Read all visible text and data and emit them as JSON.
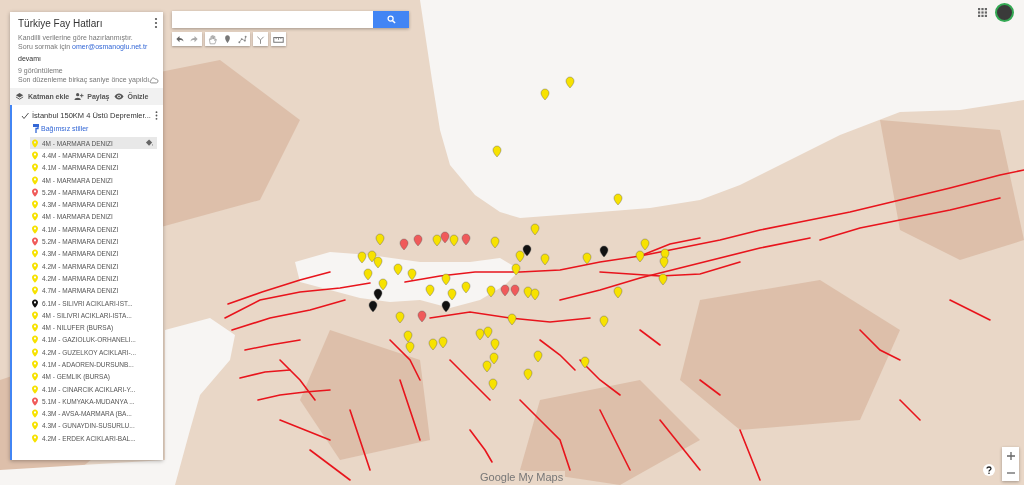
{
  "map": {
    "title": "Türkiye Fay Hatları",
    "description": "Kandilli verilerine göre hazırlanmıştır.",
    "contact_prefix": "Soru sormak için",
    "contact_email": "omer@osmanoglu.net.tr",
    "more": "devamı",
    "views": "9 görüntüleme",
    "last_edit": "Son düzenleme birkaç saniye önce yapıldı"
  },
  "actions": [
    {
      "kind": "layer",
      "label": "Katman ekle"
    },
    {
      "kind": "share",
      "label": "Paylaş"
    },
    {
      "kind": "preview",
      "label": "Önizle"
    }
  ],
  "layer": {
    "name": "İstanbul 150KM 4 Üstü Depremler...",
    "checked": true,
    "style_link": "Bağımsız stiller",
    "items": [
      {
        "label": "4M - MARMARA DENIZI",
        "color": "#f7e200",
        "selected": true
      },
      {
        "label": "4.4M - MARMARA DENIZI",
        "color": "#f7e200",
        "selected": false
      },
      {
        "label": "4.1M - MARMARA DENIZI",
        "color": "#f7e200",
        "selected": false
      },
      {
        "label": "4M - MARMARA DENIZI",
        "color": "#f7e200",
        "selected": false
      },
      {
        "label": "5.2M - MARMARA DENIZI",
        "color": "#f05a5a",
        "selected": false
      },
      {
        "label": "4.3M - MARMARA DENIZI",
        "color": "#f7e200",
        "selected": false
      },
      {
        "label": "4M - MARMARA DENIZI",
        "color": "#f7e200",
        "selected": false
      },
      {
        "label": "4.1M - MARMARA DENIZI",
        "color": "#f7e200",
        "selected": false
      },
      {
        "label": "5.2M - MARMARA DENIZI",
        "color": "#f05a5a",
        "selected": false
      },
      {
        "label": "4.3M - MARMARA DENIZI",
        "color": "#f7e200",
        "selected": false
      },
      {
        "label": "4.2M - MARMARA DENIZI",
        "color": "#f7e200",
        "selected": false
      },
      {
        "label": "4.2M - MARMARA DENIZI",
        "color": "#f7e200",
        "selected": false
      },
      {
        "label": "4.7M - MARMARA DENIZI",
        "color": "#f7e200",
        "selected": false
      },
      {
        "label": "6.1M - SILIVRI ACIKLARI-IST...",
        "color": "#111111",
        "selected": false
      },
      {
        "label": "4M - SILIVRI ACIKLARI-ISTA...",
        "color": "#f7e200",
        "selected": false
      },
      {
        "label": "4M - NILUFER (BURSA)",
        "color": "#f7e200",
        "selected": false
      },
      {
        "label": "4.1M - GAZIOLUK-ORHANELI...",
        "color": "#f7e200",
        "selected": false
      },
      {
        "label": "4.2M - GUZELKOY ACIKLARI-...",
        "color": "#f7e200",
        "selected": false
      },
      {
        "label": "4.1M - ADAOREN-DURSUNB...",
        "color": "#f7e200",
        "selected": false
      },
      {
        "label": "4M - GEMLIK (BURSA)",
        "color": "#f7e200",
        "selected": false
      },
      {
        "label": "4.1M - CINARCIK ACIKLARI-Y...",
        "color": "#f7e200",
        "selected": false
      },
      {
        "label": "5.1M - KUMYAKA-MUDANYA ...",
        "color": "#f05a5a",
        "selected": false
      },
      {
        "label": "4.3M - AVSA-MARMARA (BA...",
        "color": "#f7e200",
        "selected": false
      },
      {
        "label": "4.3M - GUNAYDIN-SUSURLU...",
        "color": "#f7e200",
        "selected": false
      },
      {
        "label": "4.2M - ERDEK ACIKLARI-BAL...",
        "color": "#f7e200",
        "selected": false
      }
    ]
  },
  "branding": "Google My Maps"
}
